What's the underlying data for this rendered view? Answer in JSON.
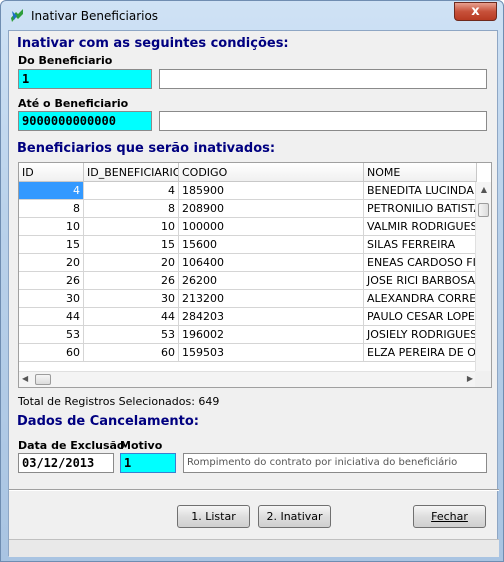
{
  "window": {
    "title": "Inativar Beneficiarios",
    "close_label": "x"
  },
  "filters": {
    "heading": "Inativar com as seguintes condições:",
    "from_label": "Do Beneficiario",
    "from_value": "1",
    "from_name": "",
    "to_label": "Até o Beneficiario",
    "to_value": "9000000000000",
    "to_name": ""
  },
  "list": {
    "heading": "Beneficiarios que serão inativados:",
    "columns": [
      "ID",
      "ID_BENEFICIARIO",
      "CODIGO",
      "NOME"
    ],
    "rows": [
      [
        "4",
        "4",
        "185900",
        "BENEDITA LUCINDA G"
      ],
      [
        "8",
        "8",
        "208900",
        "PETRONILIO BATISTA"
      ],
      [
        "10",
        "10",
        "100000",
        "VALMIR RODRIGUES N"
      ],
      [
        "15",
        "15",
        "15600",
        "SILAS FERREIRA"
      ],
      [
        "20",
        "20",
        "106400",
        "ENEAS CARDOSO FILH"
      ],
      [
        "26",
        "26",
        "26200",
        "JOSE RICI BARBOSA"
      ],
      [
        "30",
        "30",
        "213200",
        "ALEXANDRA CORREA"
      ],
      [
        "44",
        "44",
        "284203",
        "PAULO CESAR LOPES"
      ],
      [
        "53",
        "53",
        "196002",
        "JOSIELY RODRIGUES"
      ],
      [
        "60",
        "60",
        "159503",
        "ELZA PEREIRA DE OLI"
      ]
    ],
    "total_text": "Total de Registros Selecionados: 649"
  },
  "cancel": {
    "heading": "Dados de Cancelamento:",
    "date_label": "Data de Exclusão",
    "date_value": "03/12/2013",
    "reason_label": "Motivo",
    "reason_code": "1",
    "reason_desc": "Rompimento do contrato por iniciativa do beneficiário"
  },
  "buttons": {
    "list_label": "1. Listar",
    "inactivate_label": "2. Inativar",
    "close_label": "Fechar"
  }
}
